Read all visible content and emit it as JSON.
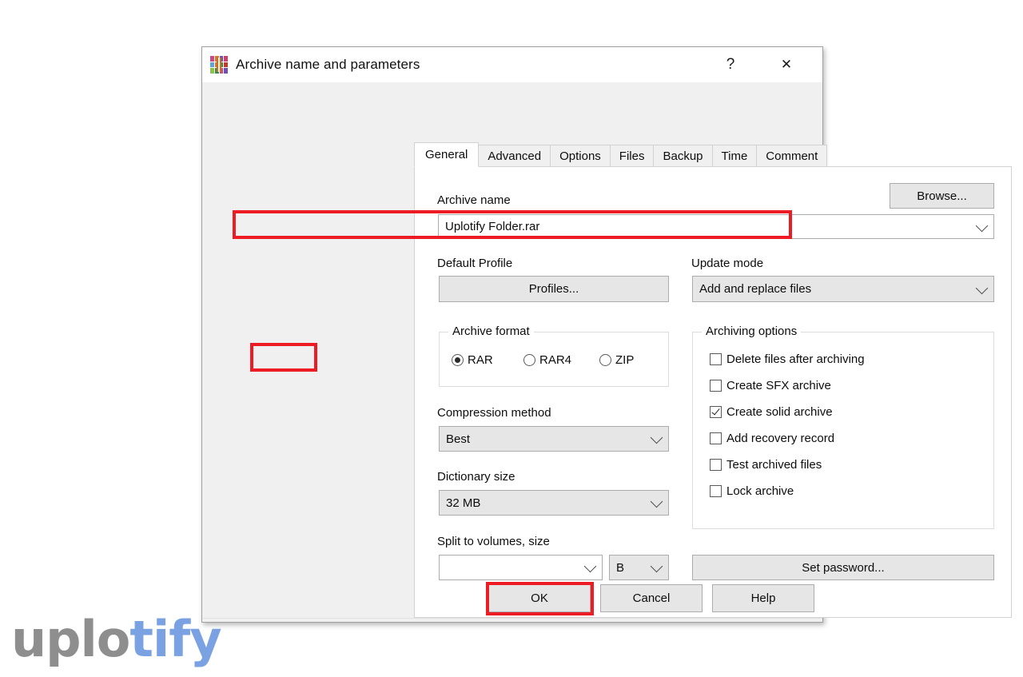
{
  "window": {
    "title": "Archive name and parameters",
    "icon": "winrar-books-icon",
    "help_label": "?",
    "close_label": "✕"
  },
  "tabs": [
    {
      "label": "General",
      "active": true
    },
    {
      "label": "Advanced",
      "active": false
    },
    {
      "label": "Options",
      "active": false
    },
    {
      "label": "Files",
      "active": false
    },
    {
      "label": "Backup",
      "active": false
    },
    {
      "label": "Time",
      "active": false
    },
    {
      "label": "Comment",
      "active": false
    }
  ],
  "general": {
    "archive_name_label": "Archive name",
    "archive_name_value": "Uplotify Folder.rar",
    "archive_name_placeholder": "Archive name",
    "browse_label": "Browse...",
    "default_profile_label": "Default Profile",
    "profiles_label": "Profiles...",
    "update_mode_label": "Update mode",
    "update_mode_value": "Add and replace files",
    "archive_format": {
      "legend": "Archive format",
      "options": [
        {
          "label": "RAR",
          "checked": true
        },
        {
          "label": "RAR4",
          "checked": false
        },
        {
          "label": "ZIP",
          "checked": false
        }
      ]
    },
    "compression_method_label": "Compression method",
    "compression_method_value": "Best",
    "dictionary_size_label": "Dictionary size",
    "dictionary_size_value": "32 MB",
    "split_label": "Split to volumes, size",
    "split_value": "",
    "split_placeholder": "",
    "split_unit_value": "B",
    "set_password_label": "Set password...",
    "archiving_options": {
      "legend": "Archiving options",
      "items": [
        {
          "label": "Delete files after archiving",
          "checked": false
        },
        {
          "label": "Create SFX archive",
          "checked": false
        },
        {
          "label": "Create solid archive",
          "checked": true
        },
        {
          "label": "Add recovery record",
          "checked": false
        },
        {
          "label": "Test archived files",
          "checked": false
        },
        {
          "label": "Lock archive",
          "checked": false
        }
      ]
    }
  },
  "footer": {
    "ok_label": "OK",
    "cancel_label": "Cancel",
    "help_label": "Help"
  },
  "annotations": {
    "highlight_color": "#ed1c24",
    "targets": [
      "archive-name-combo",
      "archive-format-rar-radio",
      "ok-button"
    ]
  },
  "watermark": {
    "text_gray": "uplo",
    "text_blue": "tify",
    "color_gray": "#8e8e8e",
    "color_blue": "#7aa2e3"
  }
}
